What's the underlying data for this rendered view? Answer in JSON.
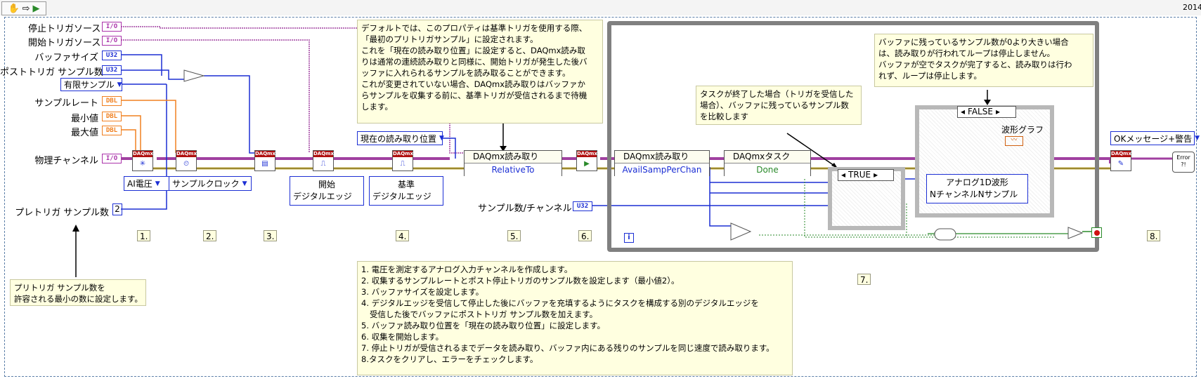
{
  "version": "2014",
  "toolbar": {
    "hand_icon": "hand-icon",
    "arrow_icon": "arrow-icon",
    "run_icon": "run-icon"
  },
  "controls": {
    "stop_trigger_source": {
      "label": "停止トリガソース",
      "type": "I/O"
    },
    "start_trigger_source": {
      "label": "開始トリガソース",
      "type": "I/O"
    },
    "buffer_size": {
      "label": "バッファサイズ",
      "type": "U32"
    },
    "post_trigger_samples": {
      "label": "ポストトリガ サンプル数",
      "type": "U32"
    },
    "sample_mode": {
      "value": "有限サンプル"
    },
    "sample_rate": {
      "label": "サンプルレート",
      "type": "DBL"
    },
    "min_value": {
      "label": "最小値",
      "type": "DBL"
    },
    "max_value": {
      "label": "最大値",
      "type": "DBL"
    },
    "physical_channel": {
      "label": "物理チャンネル",
      "type": "I/O"
    },
    "pretrigger_samples": {
      "label": "プレトリガ サンプル数",
      "value": "2"
    },
    "samples_per_channel": {
      "label": "サンプル数/チャンネル",
      "type": "U32"
    }
  },
  "daqmx_badge": "DAQmx",
  "rings": {
    "ai_voltage": "AI電圧",
    "sample_clock": "サンプルクロック",
    "start_edge": [
      "開始",
      "デジタルエッジ"
    ],
    "ref_edge": [
      "基準",
      "デジタルエッジ"
    ],
    "read_position": "現在の読み取り位置",
    "waveform_type": [
      "アナログ1D波形",
      "NチャンネルNサンプル"
    ],
    "error_message": "OKメッセージ+警告"
  },
  "property_nodes": [
    {
      "title": "DAQmx読み取り",
      "row": "RelativeTo"
    },
    {
      "title": "DAQmx読み取り",
      "row": "AvailSampPerChan"
    },
    {
      "title": "DAQmxタスク",
      "row": "Done"
    }
  ],
  "case_structures": {
    "true_label": "TRUE",
    "false_label": "FALSE"
  },
  "waveform_graph_label": "波形グラフ",
  "error_label": "Error",
  "notes": {
    "default_property": [
      "デフォルトでは、このプロパティは基準トリガを使用する際、",
      "「最初のプリトリガサンプル」に設定されます。",
      "これを「現在の読み取り位置」に設定すると、DAQmx読み取",
      "りは通常の連続読み取りと同様に、開始トリガが発生した後バ",
      "ッファに入れられるサンプルを読み取ることができます。",
      "これが変更されていない場合、DAQmx読み取りはバッファか",
      "らサンプルを収集する前に、基準トリガが受信されるまで待機",
      "します。"
    ],
    "task_done": [
      "タスクが終了した場合（トリガを受信した",
      "場合）、バッファに残っているサンプル数",
      "を比較します"
    ],
    "buffer_remaining": [
      "バッファに残っているサンプル数が0より大きい場合",
      "は、読み取りが行われてループは停止しません。",
      "バッファが空でタスクが完了すると、読み取りは行わ",
      "れず、ループは停止します。"
    ],
    "pretrigger_min": [
      "プリトリガ サンプル数を",
      "許容される最小の数に設定します。"
    ],
    "steps": [
      "1. 電圧を測定するアナログ入力チャンネルを作成します。",
      "2. 収集するサンプルレートとポスト停止トリガのサンプル数を設定します（最小値2）。",
      "3. バッファサイズを設定します。",
      "4. デジタルエッジを受信して停止した後にバッファを充填するようにタスクを構成する別のデジタルエッジを",
      "   受信した後でバッファにポストトリガ サンプル数を加えます。",
      "5. バッファ読み取り位置を「現在の読み取り位置」に設定します。",
      "6. 収集を開始します。",
      "7. 停止トリガが受信されるまでデータを読み取り、バッファ内にある残りのサンプルを同じ速度で読み取ります。",
      "8.タスクをクリアし、エラーをチェックします。"
    ]
  },
  "step_labels": [
    "1.",
    "2.",
    "3.",
    "4.",
    "5.",
    "6.",
    "7.",
    "8."
  ],
  "loop_iteration": "i",
  "colors": {
    "purple_wire": "#a040a0",
    "blue_wire": "#1c2fd4",
    "orange_wire": "#f08020",
    "error_wire": "#c8b040",
    "frame_gray": "#808080"
  }
}
